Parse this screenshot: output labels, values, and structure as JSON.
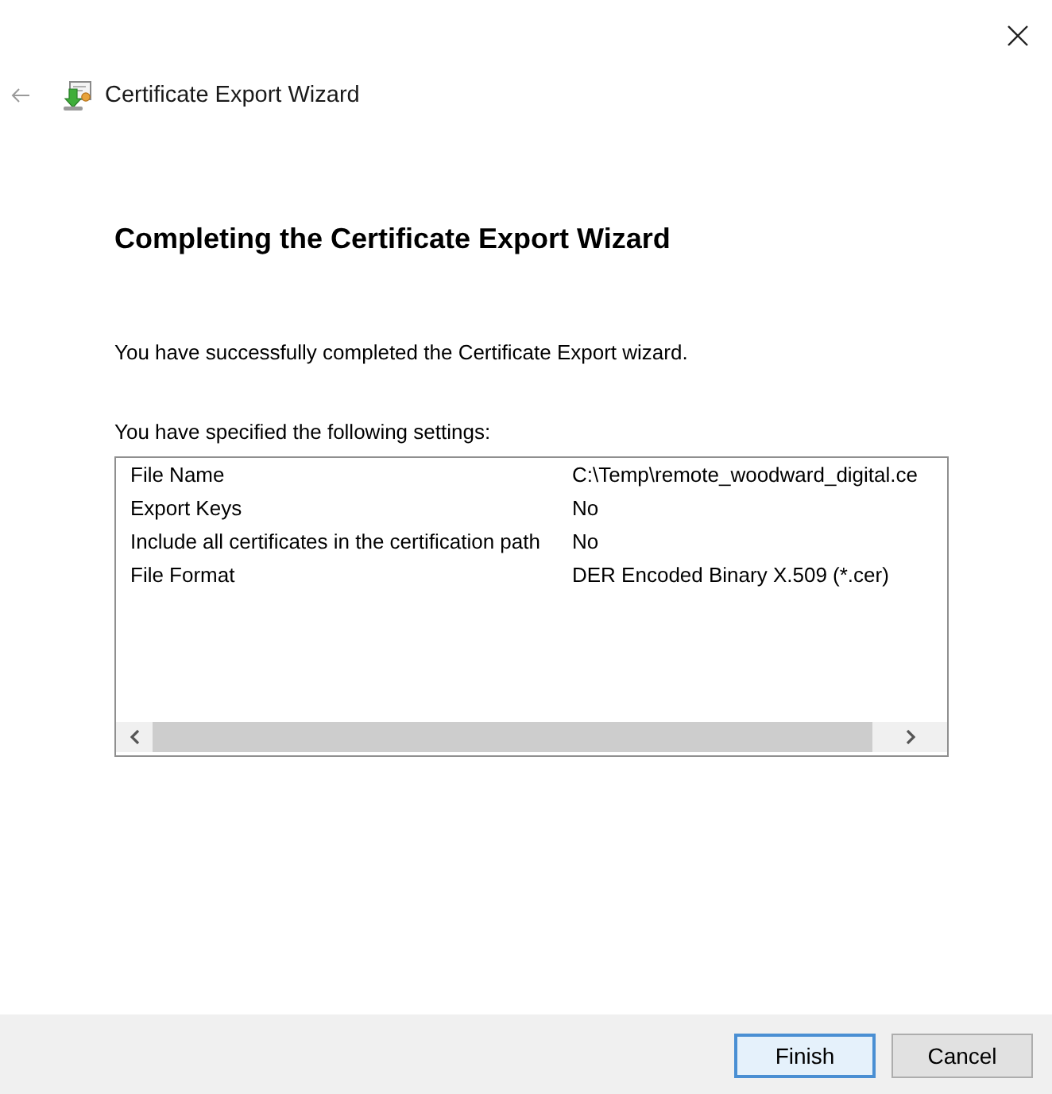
{
  "header": {
    "title": "Certificate Export Wizard"
  },
  "page": {
    "heading": "Completing the Certificate Export Wizard",
    "message": "You have successfully completed the Certificate Export wizard.",
    "settings_label": "You have specified the following settings:",
    "settings": [
      {
        "name": "File Name",
        "value": "C:\\Temp\\remote_woodward_digital.ce"
      },
      {
        "name": "Export Keys",
        "value": "No"
      },
      {
        "name": "Include all certificates in the certification path",
        "value": "No"
      },
      {
        "name": "File Format",
        "value": "DER Encoded Binary X.509 (*.cer)"
      }
    ]
  },
  "buttons": [
    {
      "label": "Finish",
      "default": true
    },
    {
      "label": "Cancel",
      "default": false
    }
  ]
}
